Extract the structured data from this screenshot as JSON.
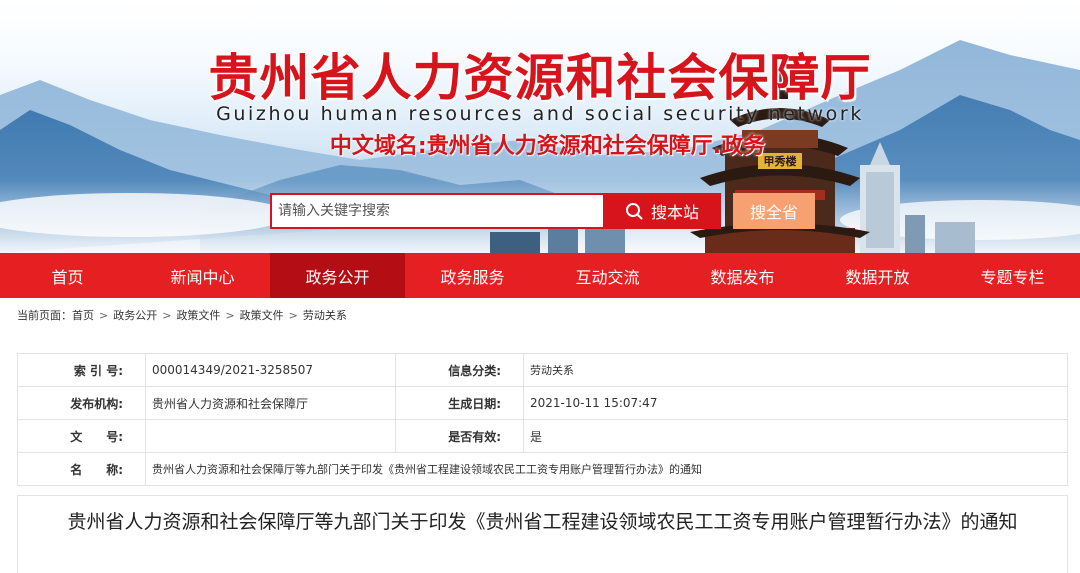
{
  "header": {
    "title": "贵州省人力资源和社会保障厅",
    "subtitle": "Guizhou human resources and social security network",
    "domain": "中文域名:贵州省人力资源和社会保障厅.政务",
    "search_placeholder": "请输入关键字搜索",
    "search_site_label": "搜本站",
    "search_all_label": "搜全省",
    "tower_plaque": "甲秀楼"
  },
  "nav": {
    "items": [
      {
        "label": "首页"
      },
      {
        "label": "新闻中心"
      },
      {
        "label": "政务公开"
      },
      {
        "label": "政务服务"
      },
      {
        "label": "互动交流"
      },
      {
        "label": "数据发布"
      },
      {
        "label": "数据开放"
      },
      {
        "label": "专题专栏"
      }
    ],
    "active_index": 2
  },
  "breadcrumb": {
    "prefix": "当前页面：",
    "items": [
      "首页",
      "政务公开",
      "政策文件",
      "政策文件",
      "劳动关系"
    ]
  },
  "info": {
    "index_label": "索 引 号:",
    "index_value": "000014349/2021-3258507",
    "category_label": "信息分类:",
    "category_value": "劳动关系",
    "publisher_label": "发布机构:",
    "publisher_value": "贵州省人力资源和社会保障厅",
    "date_label": "生成日期:",
    "date_value": "2021-10-11 15:07:47",
    "docno_label": "文　　号:",
    "docno_value": "",
    "valid_label": "是否有效:",
    "valid_value": "是",
    "name_label": "名　　称:",
    "name_value": "贵州省人力资源和社会保障厅等九部门关于印发《贵州省工程建设领域农民工工资专用账户管理暂行办法》的通知"
  },
  "article": {
    "title": "贵州省人力资源和社会保障厅等九部门关于印发《贵州省工程建设领域农民工工资专用账户管理暂行办法》的通知"
  },
  "colors": {
    "brand_red": "#e51f22",
    "active_red": "#b50d14",
    "accent_orange": "#f7a072"
  }
}
